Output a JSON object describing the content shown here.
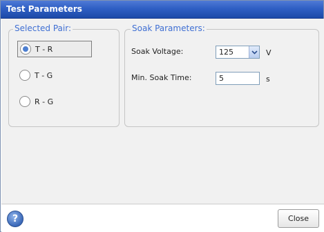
{
  "window": {
    "title": "Test Parameters"
  },
  "pair_group": {
    "legend": "Selected Pair:",
    "options": [
      {
        "label": "T - R",
        "selected": true
      },
      {
        "label": "T - G",
        "selected": false
      },
      {
        "label": "R - G",
        "selected": false
      }
    ]
  },
  "soak_group": {
    "legend": "Soak Parameters:",
    "voltage_label": "Soak Voltage:",
    "voltage_value": "125",
    "voltage_unit": "V",
    "time_label": "Min. Soak Time:",
    "time_value": "5",
    "time_unit": "s"
  },
  "footer": {
    "help_icon": "question-mark-icon",
    "help_glyph": "?",
    "close_label": "Close"
  },
  "colors": {
    "title_bar": "#2f5fc4",
    "legend_text": "#3f6fd3",
    "radio_dot": "#4d7fd0"
  }
}
